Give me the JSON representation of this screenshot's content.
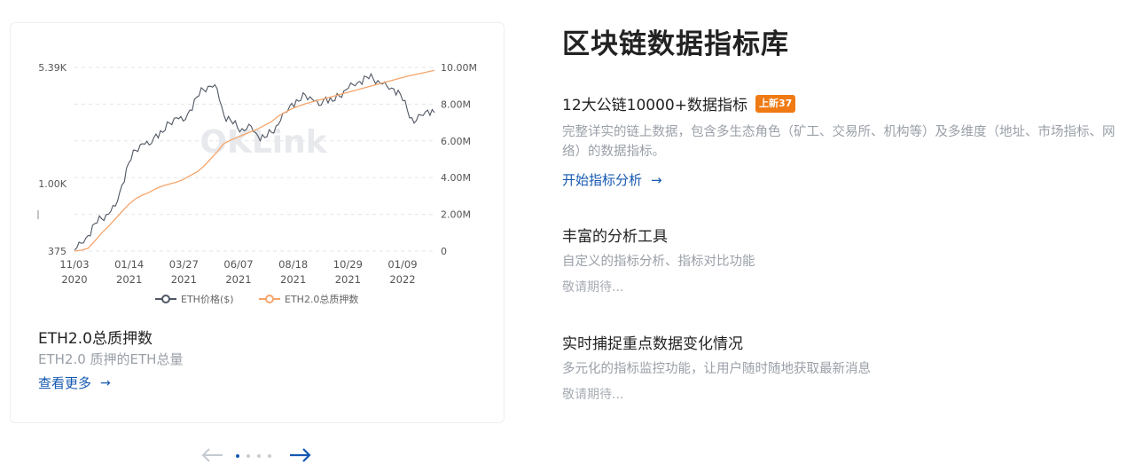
{
  "card": {
    "title": "ETH2.0总质押数",
    "subtitle": "ETH2.0 质押的ETH总量",
    "link_label": "查看更多",
    "arrow": "→"
  },
  "chart_data": {
    "type": "line",
    "watermark": "OKLink",
    "x_ticks": [
      {
        "date": "11/03",
        "year": "2020"
      },
      {
        "date": "01/14",
        "year": "2021"
      },
      {
        "date": "03/27",
        "year": "2021"
      },
      {
        "date": "06/07",
        "year": "2021"
      },
      {
        "date": "08/18",
        "year": "2021"
      },
      {
        "date": "10/29",
        "year": "2021"
      },
      {
        "date": "01/09",
        "year": "2022"
      }
    ],
    "y_left_ticks": [
      "5.39K",
      "1.00K",
      "375"
    ],
    "y_right_ticks": [
      "10.00M",
      "8.00M",
      "6.00M",
      "4.00M",
      "2.00M",
      "0"
    ],
    "y_right_range": [
      0,
      10000000
    ],
    "series": [
      {
        "name": "ETH价格($)",
        "color": "#4f5663",
        "values": [
          380,
          420,
          470,
          560,
          600,
          640,
          720,
          980,
          1350,
          1620,
          1780,
          1750,
          2050,
          2100,
          2400,
          2600,
          2480,
          2900,
          3500,
          3900,
          4100,
          3950,
          2700,
          2500,
          2250,
          2150,
          2300,
          2000,
          1950,
          2100,
          2350,
          2800,
          3200,
          3300,
          3600,
          3400,
          3100,
          3500,
          3300,
          3550,
          3900,
          4200,
          4400,
          4700,
          4550,
          4300,
          4100,
          3950,
          3650,
          2900,
          2400,
          2700,
          2900,
          2800
        ]
      },
      {
        "name": "ETH2.0总质押数",
        "color": "#f5a56b",
        "values": [
          0,
          0.05,
          0.15,
          0.55,
          0.98,
          1.35,
          1.75,
          2.15,
          2.55,
          2.85,
          3.05,
          3.2,
          3.4,
          3.55,
          3.65,
          3.75,
          3.9,
          4.1,
          4.3,
          4.6,
          5.0,
          5.4,
          5.85,
          6.05,
          6.2,
          6.35,
          6.5,
          6.65,
          6.85,
          7.05,
          7.35,
          7.55,
          7.75,
          7.9,
          8.02,
          8.12,
          8.22,
          8.32,
          8.42,
          8.52,
          8.62,
          8.72,
          8.82,
          8.92,
          9.02,
          9.12,
          9.22,
          9.32,
          9.42,
          9.52,
          9.6,
          9.68,
          9.76,
          9.84
        ]
      }
    ],
    "legend": {
      "placement": "bottom",
      "items": [
        "ETH价格($)",
        "ETH2.0总质押数"
      ]
    },
    "grid": true
  },
  "pager": {
    "prev_arrow": "←",
    "next_arrow": "→",
    "dots": 4,
    "active": 0
  },
  "right": {
    "title": "区块链数据指标库",
    "sections": [
      {
        "title": "12大公链10000+数据指标",
        "badge": "上新37",
        "desc": "完整详实的链上数据，包含多生态角色（矿工、交易所、机构等）及多维度（地址、市场指标、网络）的数据指标。",
        "link": "开始指标分析",
        "arrow": "→"
      },
      {
        "title": "丰富的分析工具",
        "desc": "自定义的指标分析、指标对比功能",
        "wait": "敬请期待..."
      },
      {
        "title": "实时捕捉重点数据变化情况",
        "desc": "多元化的指标监控功能，让用户随时随地获取最新消息",
        "wait": "敬请期待..."
      }
    ]
  },
  "colors": {
    "accent": "#1558b0",
    "badge": "#f07a14",
    "price_line": "#4f5663",
    "stake_line": "#f5a56b"
  }
}
